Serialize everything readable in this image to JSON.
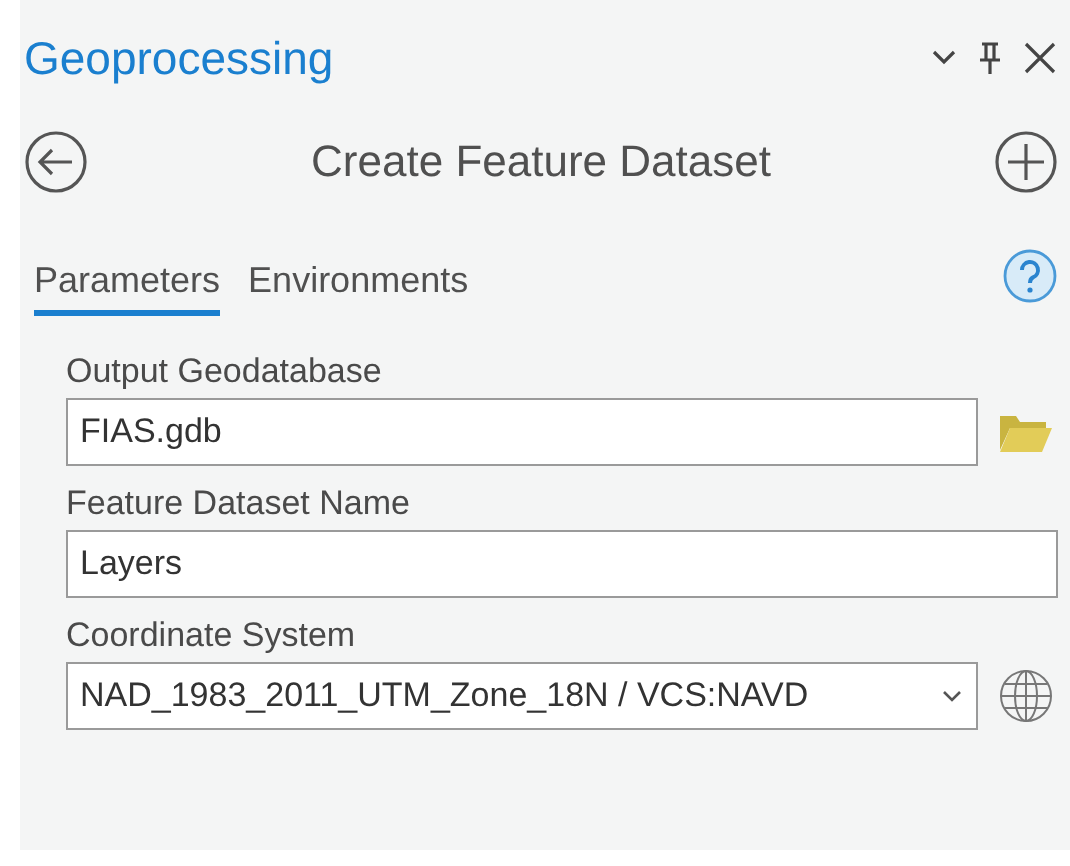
{
  "panel": {
    "title": "Geoprocessing"
  },
  "tool": {
    "title": "Create Feature Dataset"
  },
  "tabs": [
    {
      "label": "Parameters",
      "selected": true
    },
    {
      "label": "Environments",
      "selected": false
    }
  ],
  "parameters": [
    {
      "kind": "workspace",
      "label": "Output Geodatabase",
      "value": "FIAS.gdb"
    },
    {
      "kind": "text",
      "label": "Feature Dataset Name",
      "value": "Layers"
    },
    {
      "kind": "dropdown",
      "label": "Coordinate System",
      "value": "NAD_1983_2011_UTM_Zone_18N / VCS:NAVD"
    }
  ]
}
